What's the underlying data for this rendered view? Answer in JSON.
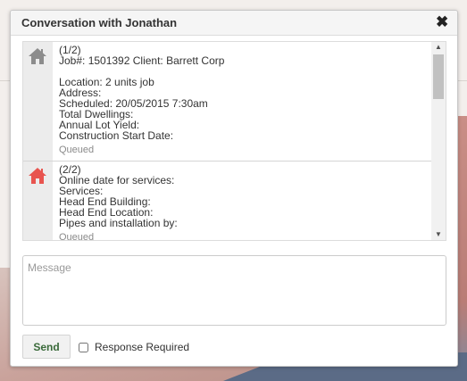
{
  "dialog": {
    "title": "Conversation with Jonathan",
    "close_icon": "close-icon"
  },
  "messages": [
    {
      "icon": "home-icon",
      "icon_color": "#8c8c8c",
      "lines": [
        "(1/2)",
        "Job#: 1501392 Client: Barrett Corp",
        "",
        "Location: 2 units job",
        "Address:",
        "Scheduled: 20/05/2015 7:30am",
        "Total Dwellings:",
        "Annual Lot Yield:",
        "Construction Start Date:"
      ],
      "status": "Queued"
    },
    {
      "icon": "home-icon",
      "icon_color": "#e8544f",
      "lines": [
        "(2/2)",
        "Online date for services:",
        "Services:",
        "Head End Building:",
        "Head End Location:",
        "Pipes and installation by:"
      ],
      "status": "Queued"
    }
  ],
  "composer": {
    "placeholder": "Message",
    "send_label": "Send",
    "response_required_label": "Response Required",
    "response_required_checked": false
  },
  "colors": {
    "send_text": "#3a6a3a",
    "home_queued_gray": "#8c8c8c",
    "home_active_red": "#e8544f"
  }
}
